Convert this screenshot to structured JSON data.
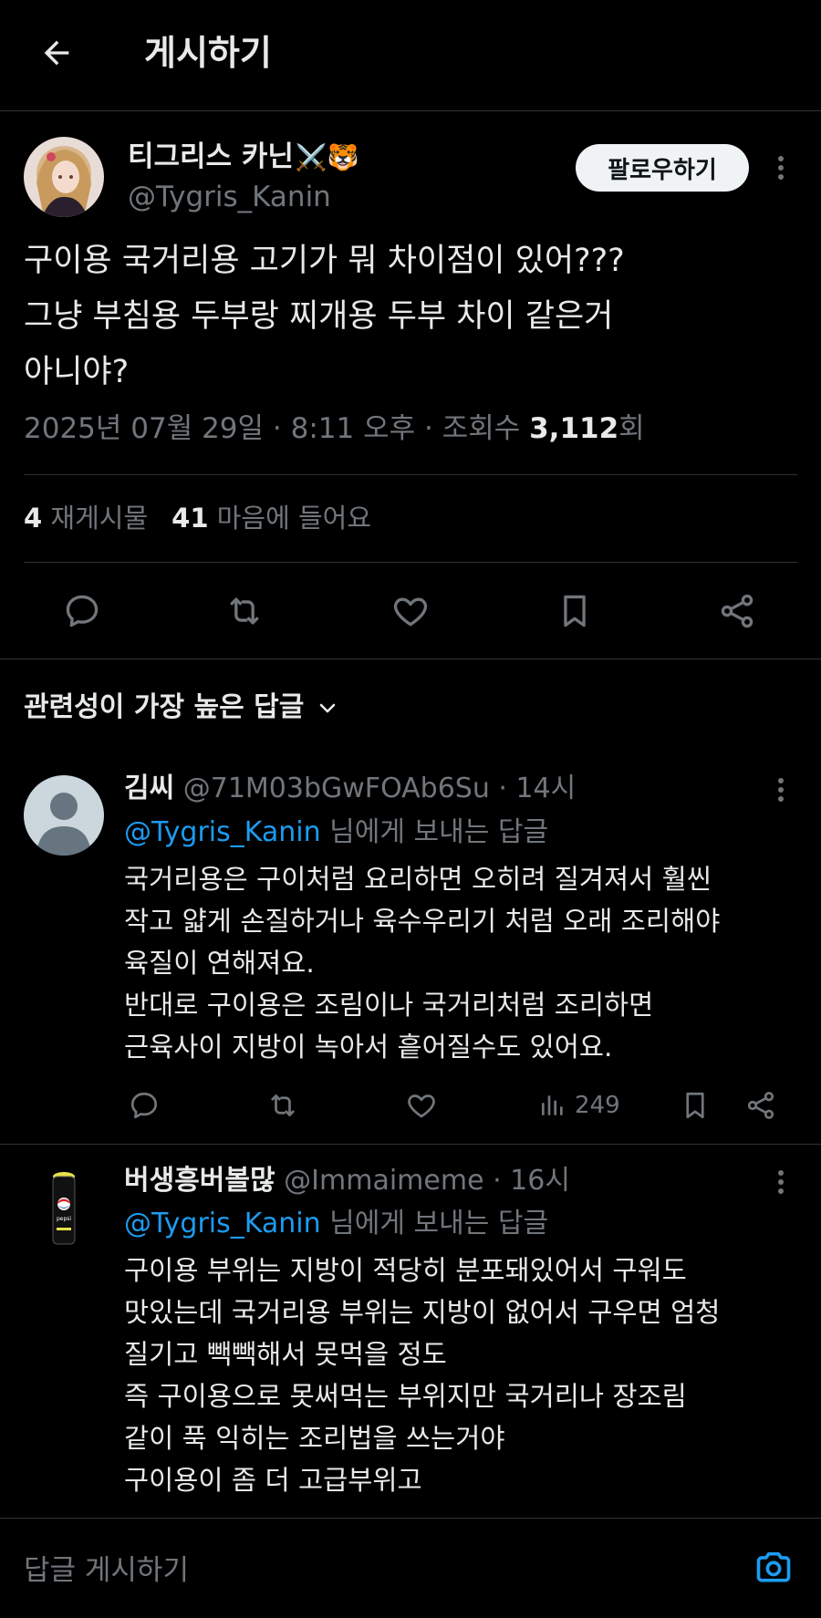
{
  "header": {
    "title": "게시하기"
  },
  "post": {
    "author_name": "티그리스 카닌",
    "author_emoji": "⚔️🐯",
    "author_handle": "@Tygris_Kanin",
    "follow_label": "팔로우하기",
    "text": "구이용 국거리용 고기가 뭐 차이점이 있어???\n그냥 부침용 두부랑 찌개용 두부 차이 같은거\n아니야?",
    "meta_prefix": "2025년 07월 29일 · 8:11 오후 · 조회수 ",
    "views": "3,112",
    "views_suffix": "회",
    "reposts": "4",
    "reposts_label": "재게시물",
    "likes": "41",
    "likes_label": "마음에 들어요"
  },
  "sort": {
    "label": "관련성이 가장 높은 답글"
  },
  "replies": [
    {
      "name": "김씨",
      "meta": "@71M03bGwFOAb6Su · 14시",
      "mention": "@Tygris_Kanin",
      "to_suffix": " 님에게 보내는 답글",
      "text": "국거리용은 구이처럼 요리하면 오히려 질겨져서 훨씬\n작고 얇게 손질하거나 육수우리기 처럼 오래 조리해야\n육질이 연해져요.\n반대로 구이용은 조림이나 국거리처럼 조리하면\n근육사이 지방이 녹아서 흩어질수도 있어요.",
      "views": "249"
    },
    {
      "name": "버생흥버볼많",
      "meta": "@Immaimeme · 16시",
      "mention": "@Tygris_Kanin",
      "to_suffix": " 님에게 보내는 답글",
      "text": "구이용 부위는 지방이 적당히 분포돼있어서 구워도\n맛있는데 국거리용 부위는 지방이 없어서 구우면 엄청\n질기고 빽빽해서 못먹을 정도\n즉 구이용으로 못써먹는 부위지만 국거리나 장조림\n같이 푹 익히는 조리법을 쓰는거야\n구이용이 좀 더 고급부위고",
      "avatar_text": "pepsi"
    }
  ],
  "composer": {
    "placeholder": "답글 게시하기"
  },
  "colors": {
    "accent": "#1d9bf0",
    "muted": "#71767b",
    "text": "#e7e9ea",
    "bg": "#000000",
    "border": "#2f3336"
  }
}
